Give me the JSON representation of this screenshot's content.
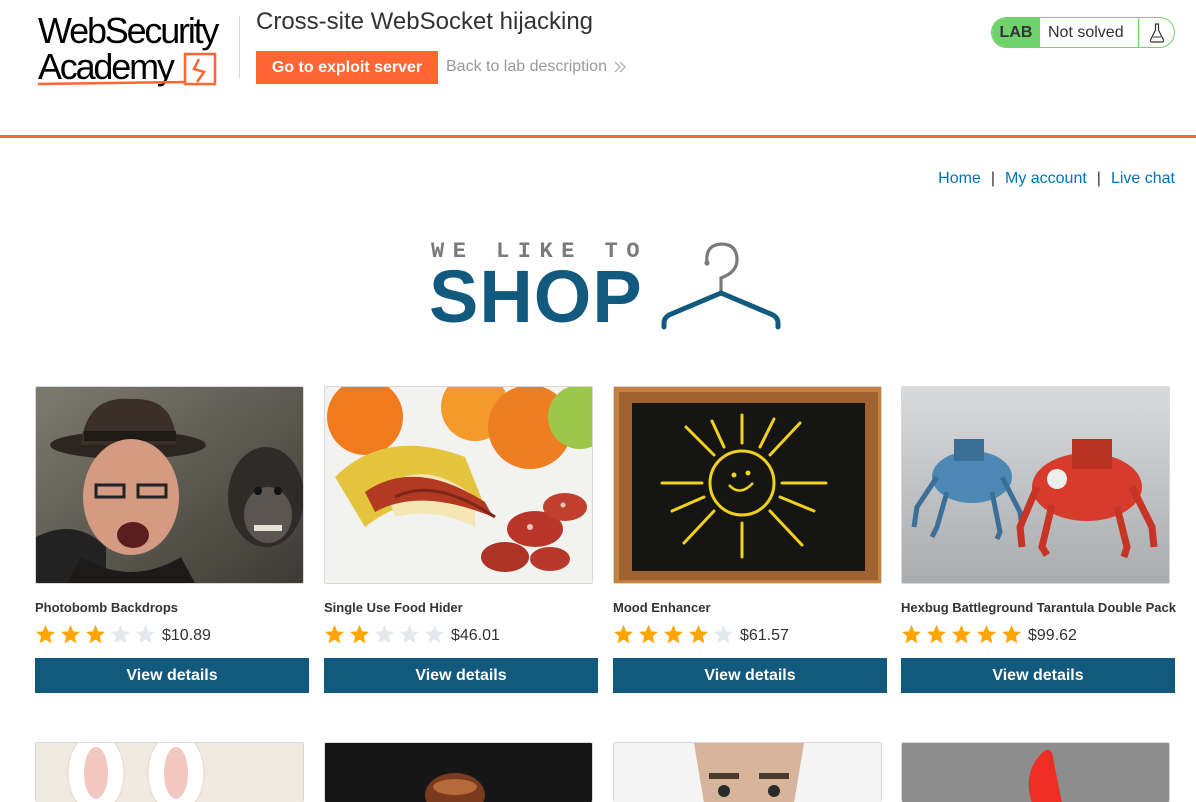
{
  "header": {
    "logo_line1": "WebSecurity",
    "logo_line2": "Academy",
    "lab_title": "Cross-site WebSocket hijacking",
    "exploit_button": "Go to exploit server",
    "back_link": "Back to lab description",
    "lab_badge": "LAB",
    "lab_status": "Not solved",
    "accent_color": "#ff6633",
    "status_color": "#70d16d"
  },
  "nav": {
    "home": "Home",
    "separator": "|",
    "account": "My account",
    "chat": "Live chat",
    "link_color": "#0071bc"
  },
  "banner": {
    "tagline": "WE LIKE TO",
    "word": "SHOP",
    "color": "#11597d"
  },
  "products": [
    {
      "name": "Photobomb Backdrops",
      "rating": 3,
      "price": "$10.89",
      "button": "View details",
      "image": "elderly man in hat with monkey"
    },
    {
      "name": "Single Use Food Hider",
      "rating": 2,
      "price": "$46.01",
      "button": "View details",
      "image": "banana peel hiding salami"
    },
    {
      "name": "Mood Enhancer",
      "rating": 4,
      "price": "$61.57",
      "button": "View details",
      "image": "chalkboard sun drawing"
    },
    {
      "name": "Hexbug Battleground Tarantula Double Pack",
      "rating": 5,
      "price": "$99.62",
      "button": "View details",
      "image": "two robotic spiders"
    }
  ],
  "rating_max": 5,
  "star_color_filled": "#ffa500",
  "star_color_empty": "#e3e8ec",
  "button_color": "#11597d"
}
